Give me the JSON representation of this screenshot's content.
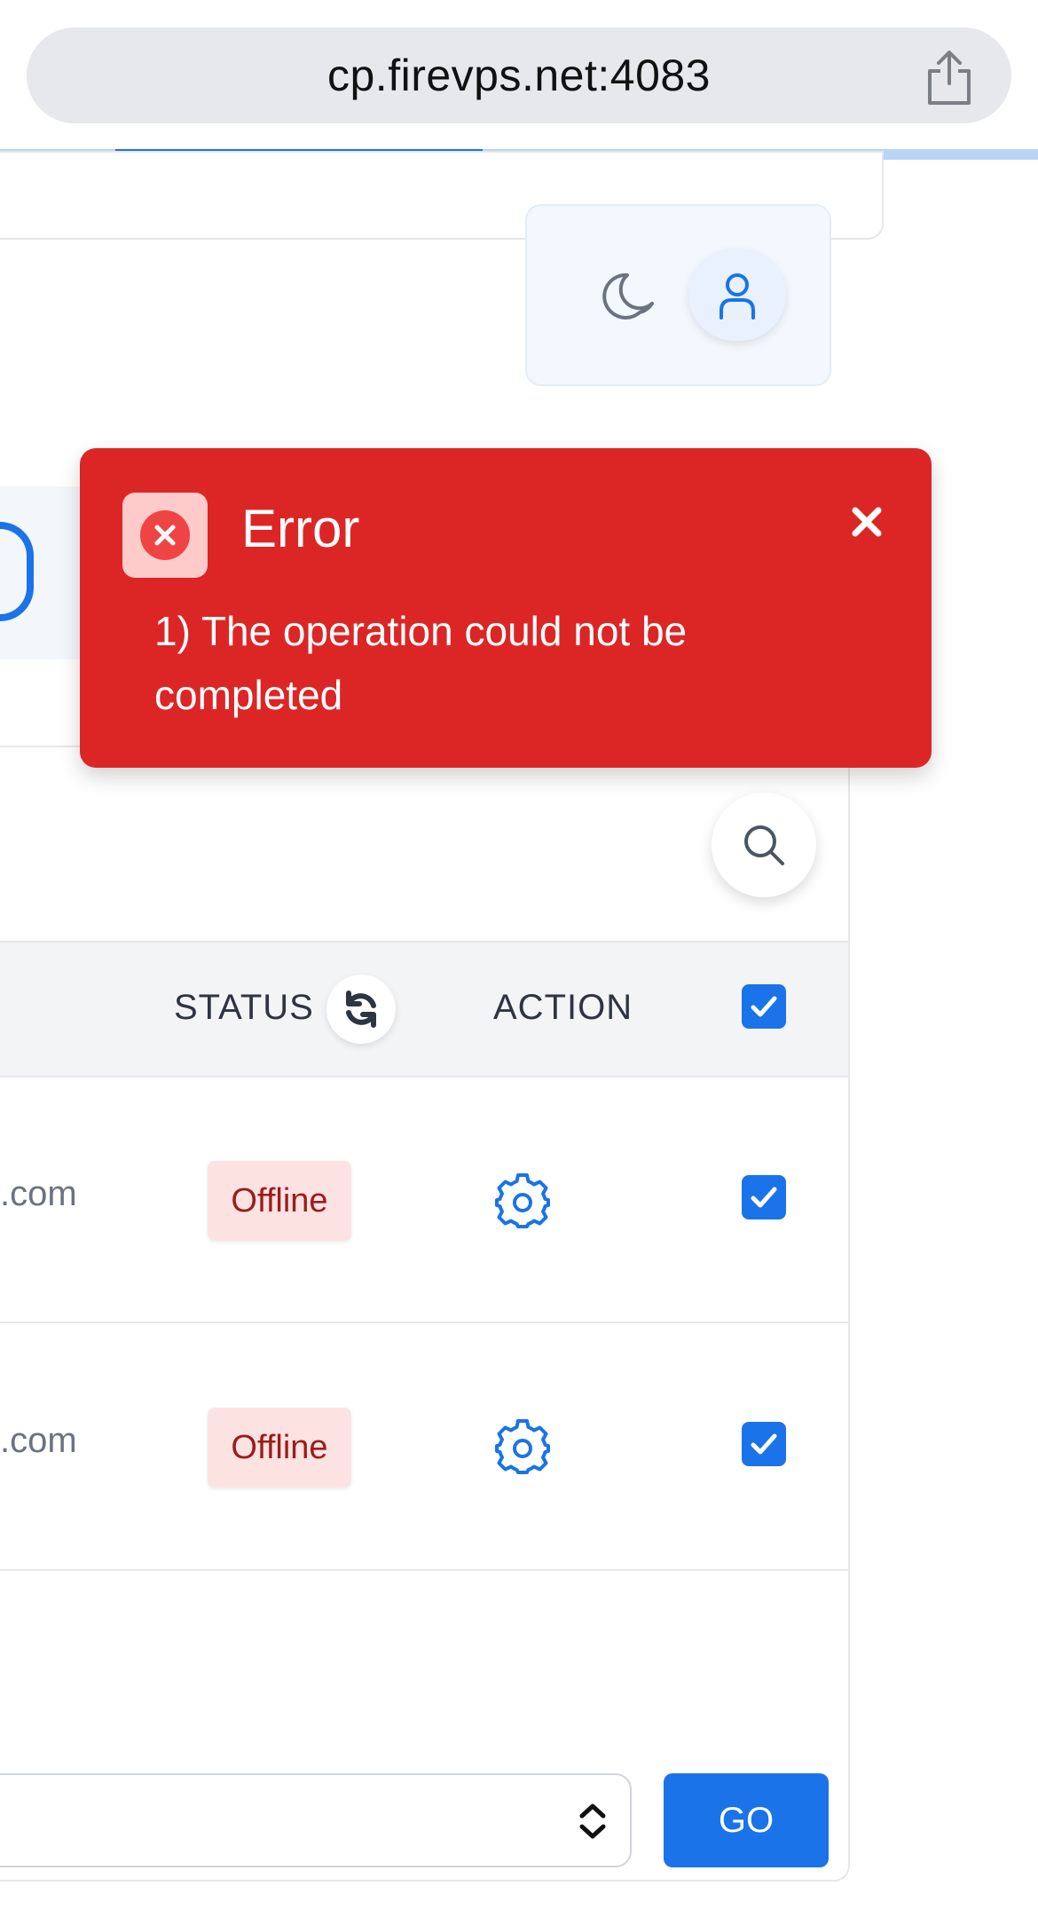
{
  "browser": {
    "url": "cp.firevps.net:4083",
    "share_icon": "share-icon",
    "progress_percent": 27
  },
  "header": {
    "theme_toggle_icon": "moon-icon",
    "user_icon": "user-icon"
  },
  "table": {
    "search_icon": "search-icon",
    "columns": {
      "status": "STATUS",
      "action": "ACTION",
      "refresh_icon": "refresh-icon"
    },
    "rows": [
      {
        "domain": ".com",
        "status": "Offline",
        "action_icon": "gear-icon",
        "checked": true
      },
      {
        "domain": ".com",
        "status": "Offline",
        "action_icon": "gear-icon",
        "checked": true
      }
    ],
    "select_all_checked": true
  },
  "footer": {
    "go_label": "GO"
  },
  "toast": {
    "type": "error",
    "title": "Error",
    "message": "1) The operation could not be completed",
    "close_icon": "close-icon",
    "colors": {
      "background": "#dc2626",
      "icon_background": "#fecaca",
      "icon": "#ef4444"
    }
  },
  "colors": {
    "accent": "#1a73e8",
    "offline_badge_bg": "#fde2e2",
    "offline_badge_text": "#9b1c1c"
  }
}
